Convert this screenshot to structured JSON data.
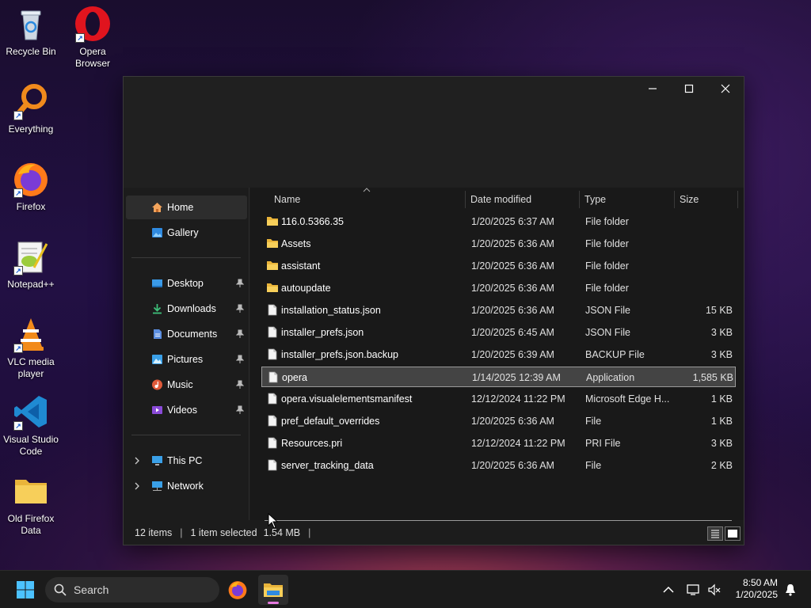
{
  "desktop": {
    "icons": [
      {
        "label": "Recycle Bin"
      },
      {
        "label": "Opera\nBrowser"
      },
      {
        "label": "Everything"
      },
      {
        "label": "Firefox"
      },
      {
        "label": "Notepad++"
      },
      {
        "label": "VLC media\nplayer"
      },
      {
        "label": "Visual Studio\nCode"
      },
      {
        "label": "Old Firefox\nData"
      }
    ]
  },
  "window": {
    "minimize_icon": "minimize-icon",
    "maximize_icon": "maximize-icon",
    "close_icon": "close-icon"
  },
  "nav": {
    "items": [
      {
        "label": "Home",
        "icon": "home-icon"
      },
      {
        "label": "Gallery",
        "icon": "gallery-icon"
      },
      {
        "label": "Desktop",
        "icon": "desktop-icon"
      },
      {
        "label": "Downloads",
        "icon": "downloads-icon"
      },
      {
        "label": "Documents",
        "icon": "documents-icon"
      },
      {
        "label": "Pictures",
        "icon": "pictures-icon"
      },
      {
        "label": "Music",
        "icon": "music-icon"
      },
      {
        "label": "Videos",
        "icon": "videos-icon"
      },
      {
        "label": "This PC",
        "icon": "this-pc-icon"
      },
      {
        "label": "Network",
        "icon": "network-icon"
      }
    ]
  },
  "columns": {
    "name": "Name",
    "date": "Date modified",
    "type": "Type",
    "size": "Size"
  },
  "files": [
    {
      "name": "116.0.5366.35",
      "date": "1/20/2025 6:37 AM",
      "type": "File folder",
      "size": "",
      "kind": "folder"
    },
    {
      "name": "Assets",
      "date": "1/20/2025 6:36 AM",
      "type": "File folder",
      "size": "",
      "kind": "folder"
    },
    {
      "name": "assistant",
      "date": "1/20/2025 6:36 AM",
      "type": "File folder",
      "size": "",
      "kind": "folder"
    },
    {
      "name": "autoupdate",
      "date": "1/20/2025 6:36 AM",
      "type": "File folder",
      "size": "",
      "kind": "folder"
    },
    {
      "name": "installation_status.json",
      "date": "1/20/2025 6:36 AM",
      "type": "JSON File",
      "size": "15 KB",
      "kind": "file"
    },
    {
      "name": "installer_prefs.json",
      "date": "1/20/2025 6:45 AM",
      "type": "JSON File",
      "size": "3 KB",
      "kind": "file"
    },
    {
      "name": "installer_prefs.json.backup",
      "date": "1/20/2025 6:39 AM",
      "type": "BACKUP File",
      "size": "3 KB",
      "kind": "file"
    },
    {
      "name": "opera",
      "date": "1/14/2025 12:39 AM",
      "type": "Application",
      "size": "1,585 KB",
      "kind": "file",
      "selected": true
    },
    {
      "name": "opera.visualelementsmanifest",
      "date": "12/12/2024 11:22 PM",
      "type": "Microsoft Edge H...",
      "size": "1 KB",
      "kind": "file"
    },
    {
      "name": "pref_default_overrides",
      "date": "1/20/2025 6:36 AM",
      "type": "File",
      "size": "1 KB",
      "kind": "file"
    },
    {
      "name": "Resources.pri",
      "date": "12/12/2024 11:22 PM",
      "type": "PRI File",
      "size": "3 KB",
      "kind": "file"
    },
    {
      "name": "server_tracking_data",
      "date": "1/20/2025 6:36 AM",
      "type": "File",
      "size": "2 KB",
      "kind": "file"
    }
  ],
  "status": {
    "items": "12 items",
    "selected": "1 item selected",
    "size": "1.54 MB"
  },
  "taskbar": {
    "search_placeholder": "Search",
    "time": "8:50 AM",
    "date": "1/20/2025"
  }
}
